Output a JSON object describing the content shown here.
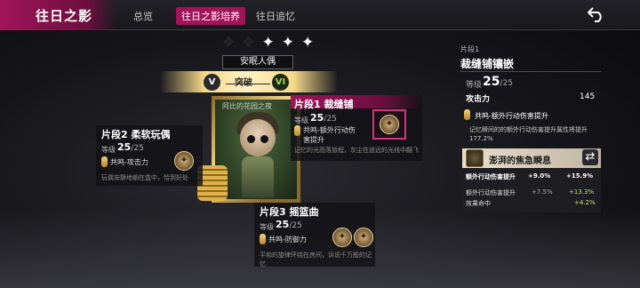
{
  "header": {
    "title": "往日之影",
    "tabs": [
      {
        "label": "总览",
        "active": false
      },
      {
        "label": "往日之影培养",
        "active": true
      },
      {
        "label": "往日追忆",
        "active": false
      }
    ],
    "back_icon": "back-arrow-icon",
    "accent_color": "#a1145a"
  },
  "doll": {
    "stars": {
      "total": 5,
      "filled_dark": 2,
      "filled_light": 3
    },
    "name": "安眠人偶",
    "breakthrough": {
      "label": "突破",
      "from_rank": "V",
      "to_rank": "VI"
    }
  },
  "card": {
    "caption": "阿比的花园之夜"
  },
  "fragments": {
    "frag1": {
      "title": "片段1  裁缝铺",
      "level_label": "等级",
      "level_current": "25",
      "level_max": "/25",
      "effect": "共鸣-额外行动伤害提升",
      "flavor": "记忆的光而落旅程，灰尘在遥远的光线中翻飞"
    },
    "frag2": {
      "title": "片段2  柔软玩偶",
      "level_label": "等级",
      "level_current": "25",
      "level_max": "/25",
      "effect": "共鸣-攻击力",
      "flavor": "玩偶安静地躺在盒中，恰到好处"
    },
    "frag3": {
      "title": "片段3  摇篮曲",
      "level_label": "等级",
      "level_current": "25",
      "level_max": "/25",
      "effect": "共鸣-防御力",
      "flavor": "平和的旋律环绕在房间，诉说千万般的记忆"
    }
  },
  "detail": {
    "sub": "片段1",
    "title": "裁缝铺镶嵌",
    "level_label": "等级",
    "level_current": "25",
    "level_max": "/25",
    "stat_label": "攻击力",
    "stat_value": "145",
    "resonance": "共鸣-额外行动伤害提升",
    "resonance_desc": "记忆瞬间的的额外行动伤害提升属性将提升177.2%",
    "skill": {
      "name": "澎湃的焦急瞬息",
      "main_label": "额外行动伤害提升",
      "main_from": "+9.0%",
      "main_to": "+15.9%",
      "rows": [
        {
          "label": "额外行动伤害提升",
          "from": "+7.5%",
          "to": "+13.3%"
        },
        {
          "label": "效果命中",
          "from": "",
          "to": "+4.2%"
        }
      ]
    }
  }
}
